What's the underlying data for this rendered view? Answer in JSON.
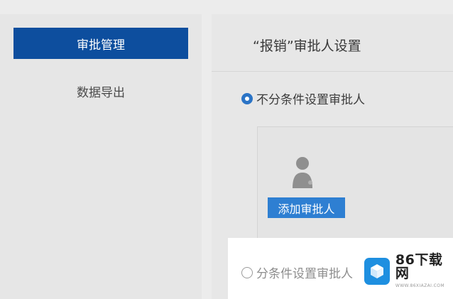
{
  "sidebar": {
    "items": [
      {
        "label": "审批管理",
        "active": true
      },
      {
        "label": "数据导出",
        "active": false
      }
    ]
  },
  "main": {
    "title": "“报销”审批人设置",
    "options": [
      {
        "label": "不分条件设置审批人",
        "checked": true
      },
      {
        "label": "分条件设置审批人",
        "checked": false
      }
    ],
    "approver_box": {
      "avatar_icon": "user-avatar-icon",
      "add_button_label": "添加审批人"
    }
  },
  "watermark": {
    "name": "86下载网",
    "url": "WWW.86XIAZAI.COM",
    "logo_icon": "cube-logo-icon"
  },
  "colors": {
    "active_sidebar": "#0d4e9e",
    "button": "#2e7fd2",
    "radio_checked": "#2b74c6",
    "watermark_logo": "#1e8fe0"
  }
}
